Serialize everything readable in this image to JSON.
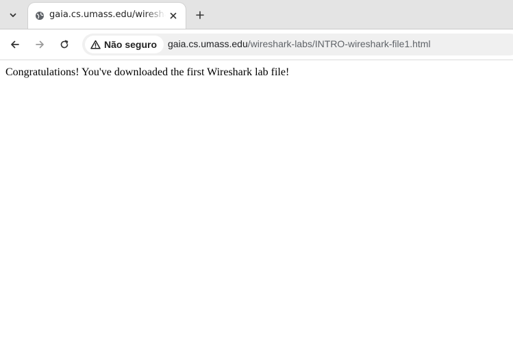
{
  "tabs": [
    {
      "title": "gaia.cs.umass.edu/wireshark-labs/INTRO-wireshark-file1.html",
      "active": true
    }
  ],
  "toolbar": {
    "security_label": "Não seguro",
    "url_host": "gaia.cs.umass.edu",
    "url_path": "/wireshark-labs/INTRO-wireshark-file1.html"
  },
  "icons": {
    "tab_list": "chevron-down-icon",
    "favicon": "globe-icon",
    "close_tab": "close-icon",
    "new_tab": "plus-icon",
    "back": "arrow-left-icon",
    "forward": "arrow-right-icon",
    "reload": "reload-icon",
    "security": "warning-triangle-icon"
  },
  "page": {
    "message": "Congratulations! You've downloaded the first Wireshark lab file!"
  }
}
